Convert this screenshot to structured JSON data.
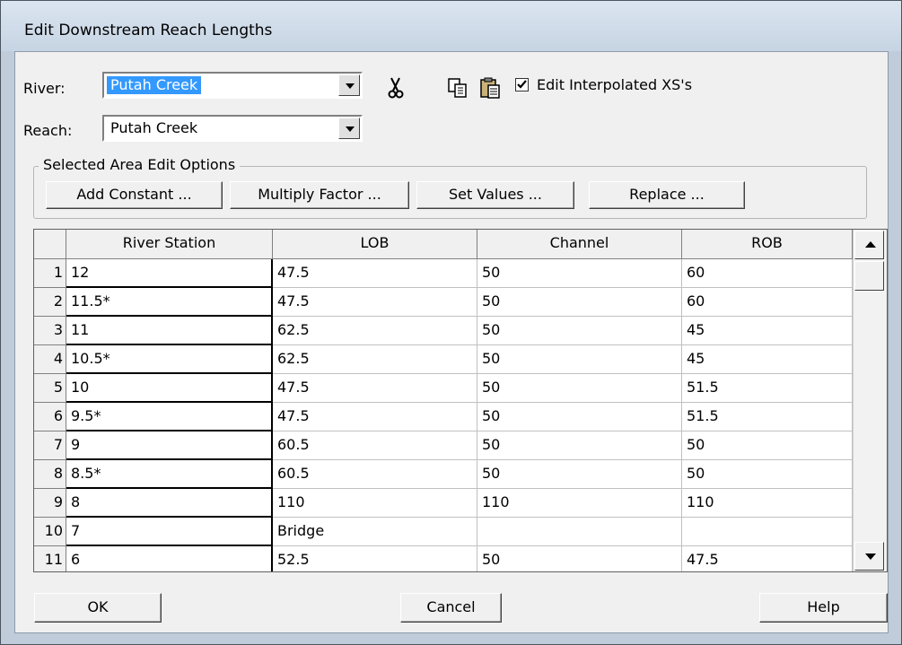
{
  "window": {
    "title": "Edit Downstream Reach Lengths"
  },
  "river": {
    "label": "River:",
    "value": "Putah Creek"
  },
  "reach": {
    "label": "Reach:",
    "value": "Putah Creek"
  },
  "toolbar": {
    "cut_icon": "scissors-icon",
    "copy_icon": "copy-icon",
    "paste_icon": "clipboard-icon",
    "checkbox_label": "Edit Interpolated XS's",
    "checkbox_checked": true
  },
  "edit_options": {
    "group_label": "Selected Area Edit Options",
    "buttons": [
      "Add Constant ...",
      "Multiply Factor ...",
      "Set Values ...",
      "Replace ..."
    ]
  },
  "table": {
    "columns": [
      "River Station",
      "LOB",
      "Channel",
      "ROB"
    ],
    "rows": [
      {
        "n": "1",
        "station": "12",
        "lob": "47.5",
        "channel": "50",
        "rob": "60"
      },
      {
        "n": "2",
        "station": "11.5*",
        "lob": "47.5",
        "channel": "50",
        "rob": "60"
      },
      {
        "n": "3",
        "station": "11",
        "lob": "62.5",
        "channel": "50",
        "rob": "45"
      },
      {
        "n": "4",
        "station": "10.5*",
        "lob": "62.5",
        "channel": "50",
        "rob": "45"
      },
      {
        "n": "5",
        "station": "10",
        "lob": "47.5",
        "channel": "50",
        "rob": "51.5"
      },
      {
        "n": "6",
        "station": "9.5*",
        "lob": "47.5",
        "channel": "50",
        "rob": "51.5"
      },
      {
        "n": "7",
        "station": "9",
        "lob": "60.5",
        "channel": "50",
        "rob": "50"
      },
      {
        "n": "8",
        "station": "8.5*",
        "lob": "60.5",
        "channel": "50",
        "rob": "50"
      },
      {
        "n": "9",
        "station": "8",
        "lob": "110",
        "channel": "110",
        "rob": "110"
      },
      {
        "n": "10",
        "station": "7",
        "lob": "Bridge",
        "channel": "",
        "rob": ""
      },
      {
        "n": "11",
        "station": "6",
        "lob": "52.5",
        "channel": "50",
        "rob": "47.5"
      }
    ]
  },
  "footer": {
    "ok": "OK",
    "cancel": "Cancel",
    "help": "Help"
  }
}
